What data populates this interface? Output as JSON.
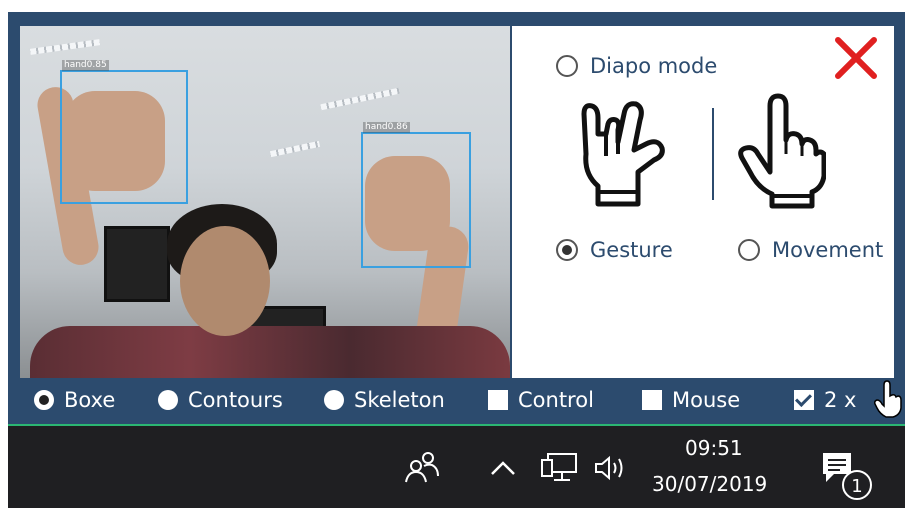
{
  "camera": {
    "detections": [
      {
        "label": "hand0.85"
      },
      {
        "label": "hand0.86"
      }
    ]
  },
  "panel": {
    "diapo_mode_label": "Diapo mode",
    "gesture_label": "Gesture",
    "movement_label": "Movement",
    "selected": "Gesture",
    "close_color": "#e02020"
  },
  "bottom_bar": {
    "options": [
      {
        "label": "Boxe",
        "kind": "radio",
        "selected": true
      },
      {
        "label": "Contours",
        "kind": "radio",
        "selected": false
      },
      {
        "label": "Skeleton",
        "kind": "radio",
        "selected": false
      },
      {
        "label": "Control",
        "kind": "checkbox",
        "checked": false
      },
      {
        "label": "Mouse",
        "kind": "checkbox",
        "checked": false
      },
      {
        "label": "2 x",
        "kind": "checkbox",
        "checked": true
      }
    ]
  },
  "taskbar": {
    "time": "09:51",
    "date": "30/07/2019",
    "notification_count": "1",
    "icons": [
      "people-icon",
      "chevron-up-icon",
      "network-icon",
      "volume-icon",
      "notification-icon"
    ]
  },
  "colors": {
    "app_bar": "#2c4b6e",
    "accent_line": "#2bb673",
    "taskbar": "#1f1f22",
    "bbox": "#3aa0e0"
  }
}
